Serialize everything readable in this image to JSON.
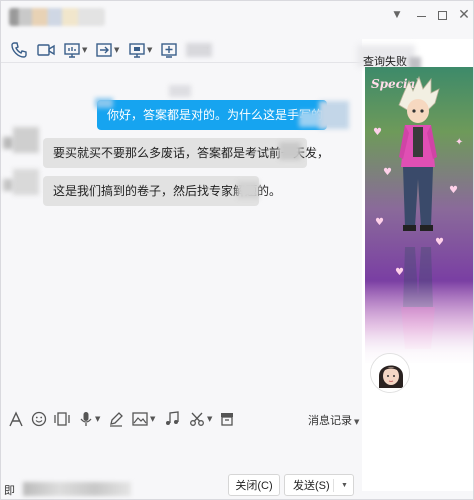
{
  "window": {
    "controls": [
      "menu",
      "minimize",
      "maximize",
      "close"
    ]
  },
  "toolbar": {
    "icons": [
      "phone-icon",
      "video-icon",
      "screen-share-icon",
      "file-transfer-icon",
      "remote-desktop-icon",
      "add-app-icon"
    ]
  },
  "messages": [
    {
      "side": "out",
      "text": "你好，答案都是对的。为什么这是手写的"
    },
    {
      "side": "in",
      "text": "要买就买不要那么多废话，答案都是考试前一天发，"
    },
    {
      "side": "in",
      "text": "这是我们搞到的卷子，然后找专家解题的。"
    }
  ],
  "side_panel": {
    "label": "查询失败",
    "show_badge": "Special"
  },
  "input_toolbar": {
    "icons": [
      "font-icon",
      "emoji-icon",
      "shake-icon",
      "voice-icon",
      "pen-icon",
      "image-icon",
      "music-icon",
      "scissors-icon",
      "archive-icon"
    ],
    "history_label": "消息记录"
  },
  "bottom": {
    "left_text": "即",
    "close_label": "关闭(C)",
    "send_label": "发送(S)"
  },
  "colors": {
    "bubble_out": "#16a4f0",
    "bubble_in": "#e2e2e2",
    "icon_blue": "#3a5f8a"
  }
}
